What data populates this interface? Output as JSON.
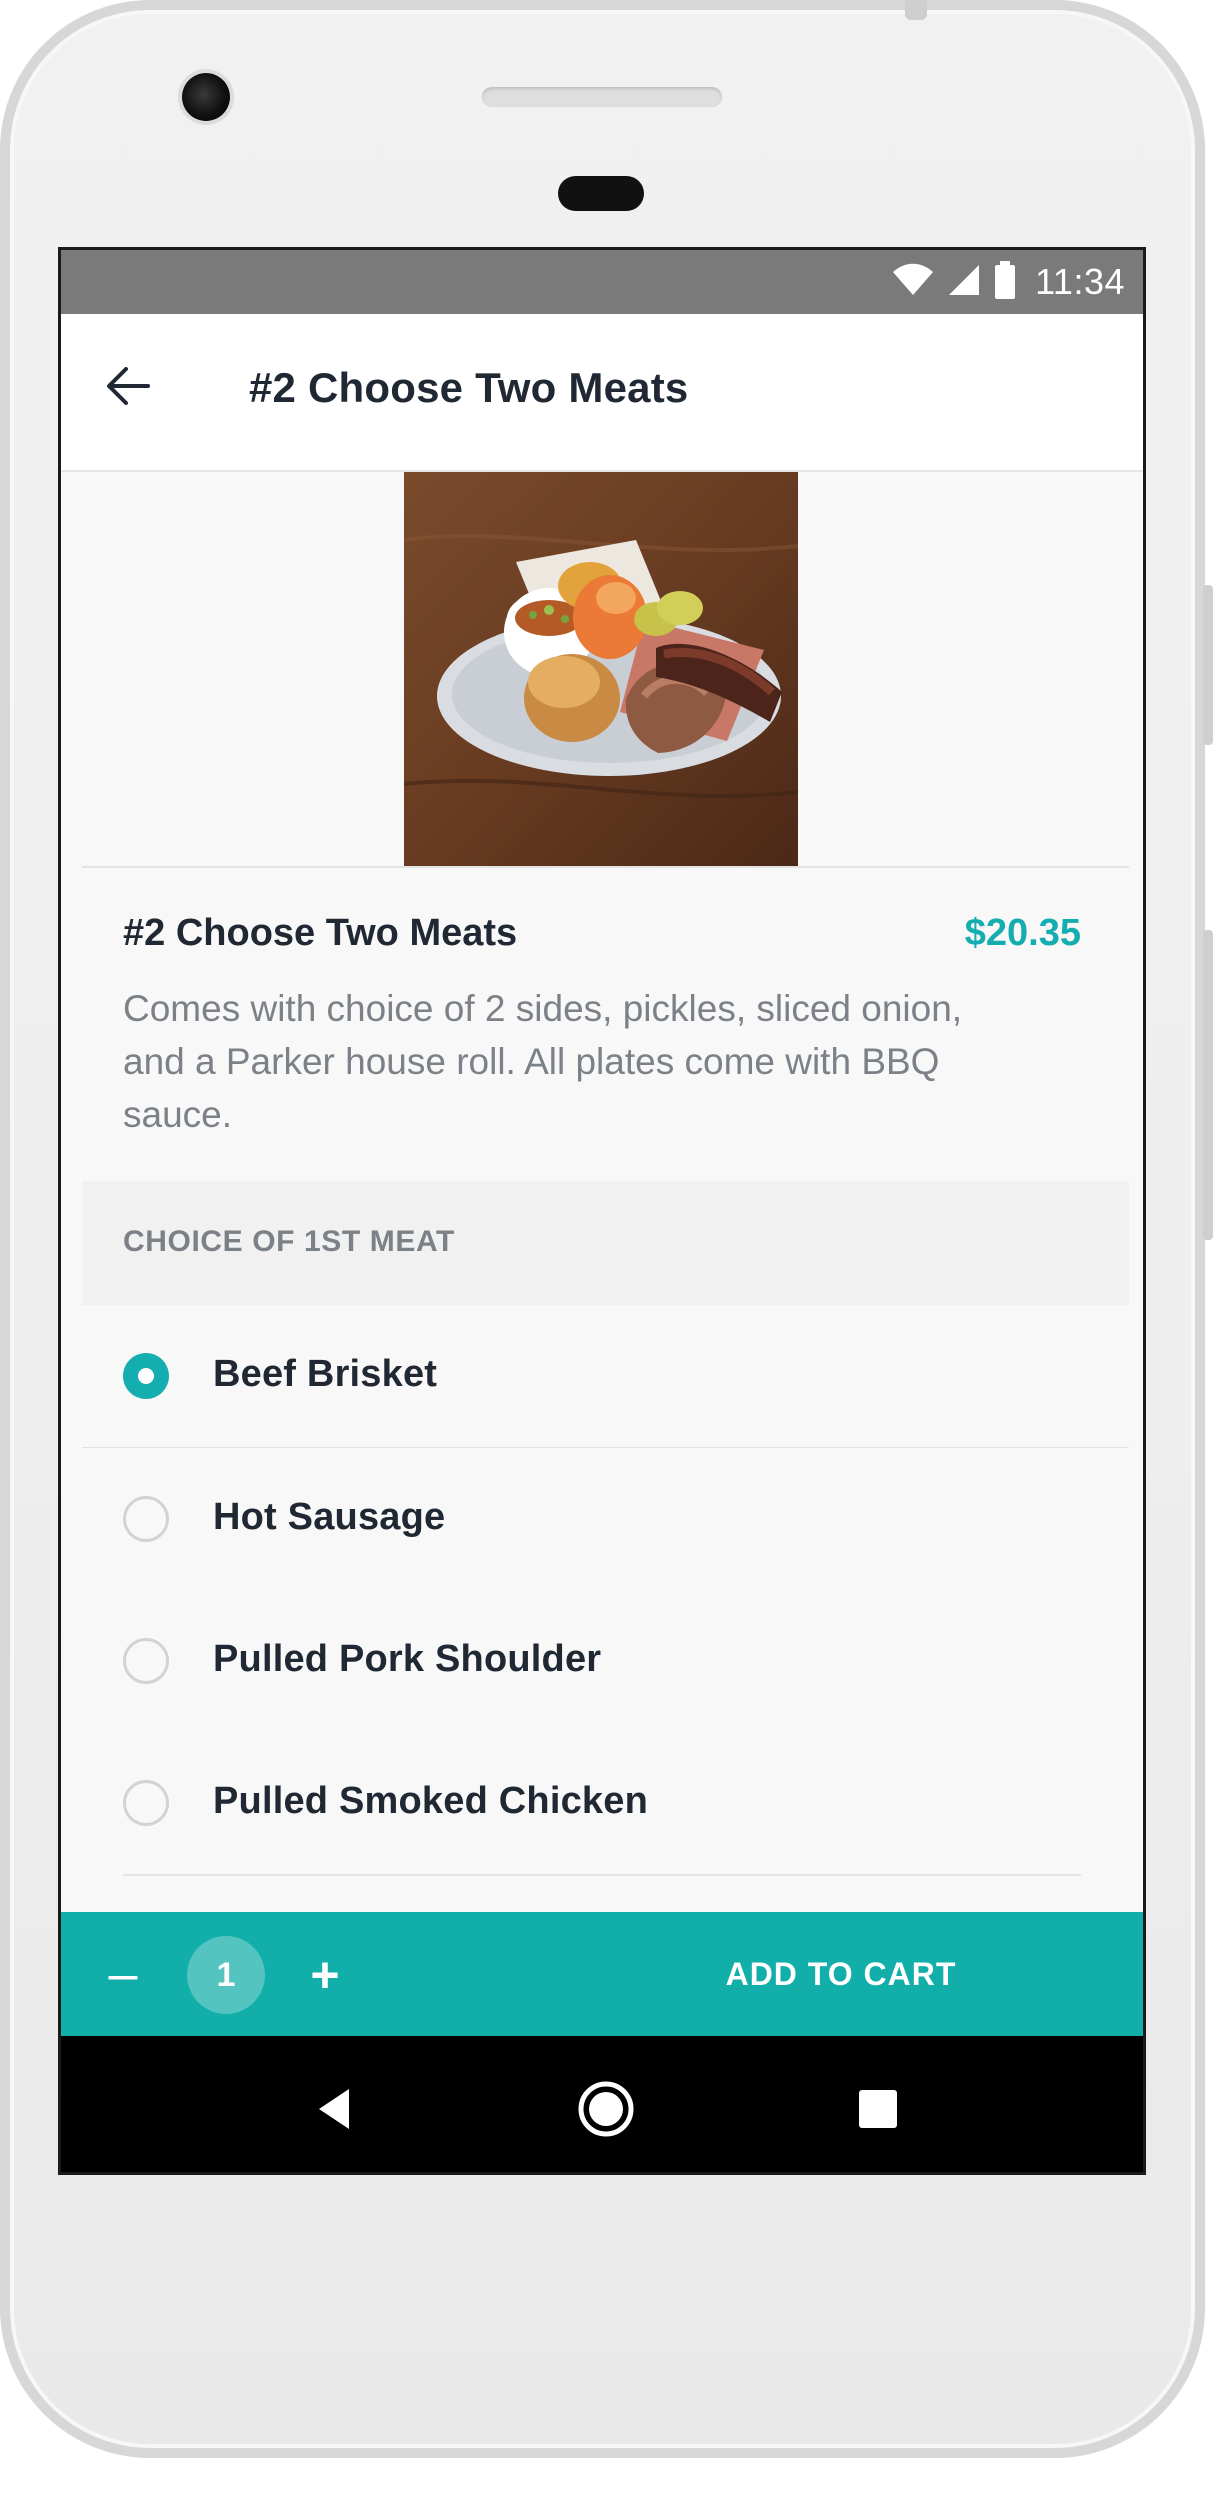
{
  "status_bar": {
    "time": "11:34",
    "icons": [
      "wifi-icon",
      "cell-signal-icon",
      "battery-icon"
    ]
  },
  "app_bar": {
    "title": "#2 Choose Two Meats",
    "back_icon": "back-arrow-icon"
  },
  "item": {
    "image": "bbq-plate-image",
    "name": "#2 Choose Two Meats",
    "price": "$20.35",
    "description": "Comes with choice of 2 sides, pickles, sliced onion, and a Parker house roll. All plates come with BBQ sauce."
  },
  "section": {
    "title": "CHOICE OF 1ST MEAT"
  },
  "options": [
    {
      "label": "Beef Brisket",
      "selected": true
    },
    {
      "label": "Hot Sausage",
      "selected": false
    },
    {
      "label": "Pulled Pork Shoulder",
      "selected": false
    },
    {
      "label": "Pulled Smoked Chicken",
      "selected": false
    }
  ],
  "action_bar": {
    "minus": "–",
    "quantity": "1",
    "plus": "+",
    "add_to_cart": "ADD TO CART"
  },
  "nav_bar": {
    "icons": [
      "nav-back-icon",
      "nav-home-icon",
      "nav-recents-icon"
    ]
  },
  "colors": {
    "accent": "#15aeb0",
    "status_bar": "#7a7a7a",
    "title_text": "#1f2833",
    "muted_text": "#7b8187",
    "background": "#f8f8f8"
  }
}
